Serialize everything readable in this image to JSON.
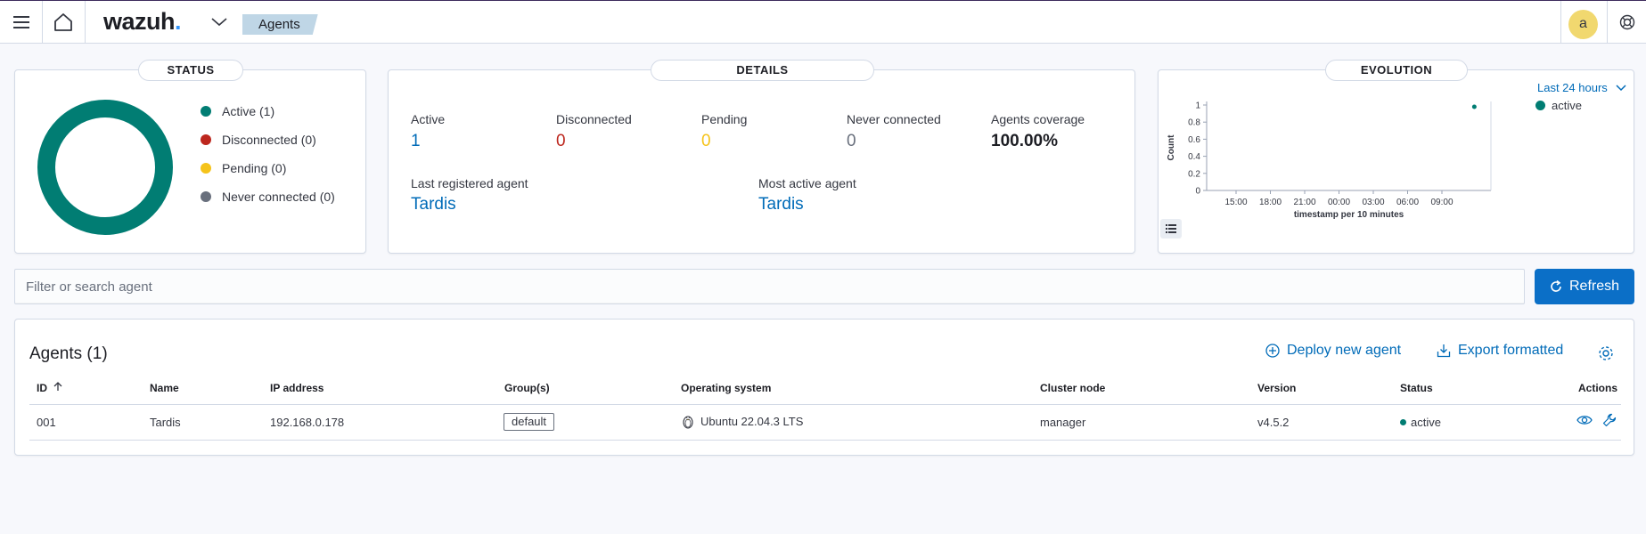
{
  "header": {
    "logo_text": "wazuh",
    "logo_dot": ".",
    "breadcrumb": "Agents",
    "avatar_letter": "a",
    "icons": [
      "menu-icon",
      "home-icon",
      "chevron-down-icon",
      "help-icon"
    ]
  },
  "status": {
    "title": "STATUS",
    "legend": [
      {
        "label": "Active (1)",
        "color": "#017d73"
      },
      {
        "label": "Disconnected (0)",
        "color": "#bd271e"
      },
      {
        "label": "Pending (0)",
        "color": "#f5c31a"
      },
      {
        "label": "Never connected (0)",
        "color": "#69707d"
      }
    ],
    "donut_color": "#017d73"
  },
  "details": {
    "title": "DETAILS",
    "active": {
      "label": "Active",
      "value": "1",
      "color": "#006bb8"
    },
    "disconnected": {
      "label": "Disconnected",
      "value": "0",
      "color": "#bd271e"
    },
    "pending": {
      "label": "Pending",
      "value": "0",
      "color": "#f5c31a"
    },
    "never_connected": {
      "label": "Never connected",
      "value": "0",
      "color": "#69707d"
    },
    "coverage": {
      "label": "Agents coverage",
      "value": "100.00%"
    },
    "last_registered": {
      "label": "Last registered agent",
      "value": "Tardis"
    },
    "most_active": {
      "label": "Most active agent",
      "value": "Tardis"
    }
  },
  "evolution": {
    "title": "EVOLUTION",
    "range_label": "Last 24 hours",
    "chart_data": {
      "type": "scatter",
      "x": [
        "11:50"
      ],
      "series": [
        {
          "name": "active",
          "values": [
            1
          ]
        }
      ],
      "x_ticks": [
        "15:00",
        "18:00",
        "21:00",
        "00:00",
        "03:00",
        "06:00",
        "09:00"
      ],
      "y_ticks": [
        "1",
        "0.8",
        "0.6",
        "0.4",
        "0.2",
        "0"
      ],
      "ylim": [
        0,
        1
      ],
      "xlabel": "timestamp per 10 minutes",
      "ylabel": "Count",
      "legend_placement": "top-right",
      "color": "#017d73"
    }
  },
  "search": {
    "placeholder": "Filter or search agent"
  },
  "refresh_label": "Refresh",
  "agents_table": {
    "title": "Agents (1)",
    "deploy_label": "Deploy new agent",
    "export_label": "Export formatted",
    "columns": [
      "ID",
      "Name",
      "IP address",
      "Group(s)",
      "Operating system",
      "Cluster node",
      "Version",
      "Status",
      "Actions"
    ],
    "rows": [
      {
        "id": "001",
        "name": "Tardis",
        "ip": "192.168.0.178",
        "group": "default",
        "os": "Ubuntu 22.04.3 LTS",
        "node": "manager",
        "version": "v4.5.2",
        "status": "active",
        "status_color": "#017d73"
      }
    ]
  }
}
